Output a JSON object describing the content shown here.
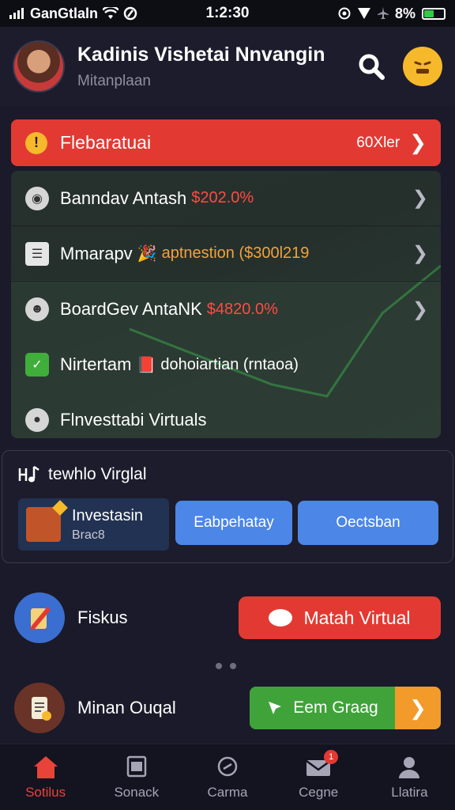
{
  "status_bar": {
    "carrier": "GanGtlaln",
    "time": "1:2:30",
    "battery_text": "8%",
    "battery_level": 0.5
  },
  "header": {
    "title": "Kadinis Vishetai Nnvangin",
    "subtitle": "Mitanplaan"
  },
  "alert": {
    "label": "Flebaratuai",
    "link": "60Xler"
  },
  "list": [
    {
      "label": "Banndav Antash",
      "value": "$202.0%",
      "value_color": "red",
      "badge": "",
      "chevron": true
    },
    {
      "label": "Mmarapv",
      "value": "aptnestion ($300l219",
      "value_color": "orange",
      "badge": "🎉",
      "chevron": true
    },
    {
      "label": "BoardGev AntaNK",
      "value": "$4820.0%",
      "value_color": "red",
      "badge": "",
      "chevron": true
    },
    {
      "label": "Nirtertam",
      "value": "dohoiartian (rntaoa)",
      "value_color": "white",
      "badge": "📕",
      "chevron": false
    },
    {
      "label": "Flnvesttabi Virtuals",
      "value": "",
      "value_color": "white",
      "badge": "",
      "chevron": false
    }
  ],
  "section": {
    "title": "tewhlo Virglal",
    "invest_title": "Investasin",
    "invest_sub": "Brac8",
    "button_1": "Eabpehatay",
    "button_2": "Oectsban"
  },
  "row_1": {
    "label": "Fiskus",
    "button": "Matah Virtual"
  },
  "row_2": {
    "label": "Minan Ouqal",
    "button": "Eem Graag"
  },
  "bottom_nav": [
    {
      "label": "Sotilus",
      "active": true
    },
    {
      "label": "Sonack",
      "active": false
    },
    {
      "label": "Carma",
      "active": false
    },
    {
      "label": "Cegne",
      "active": false,
      "badge": "1"
    },
    {
      "label": "Llatira",
      "active": false
    }
  ],
  "colors": {
    "accent_red": "#e23a33",
    "accent_blue": "#4c86e6",
    "accent_green": "#3fa33a",
    "accent_orange": "#f29a2a",
    "background": "#1b1a2a"
  }
}
